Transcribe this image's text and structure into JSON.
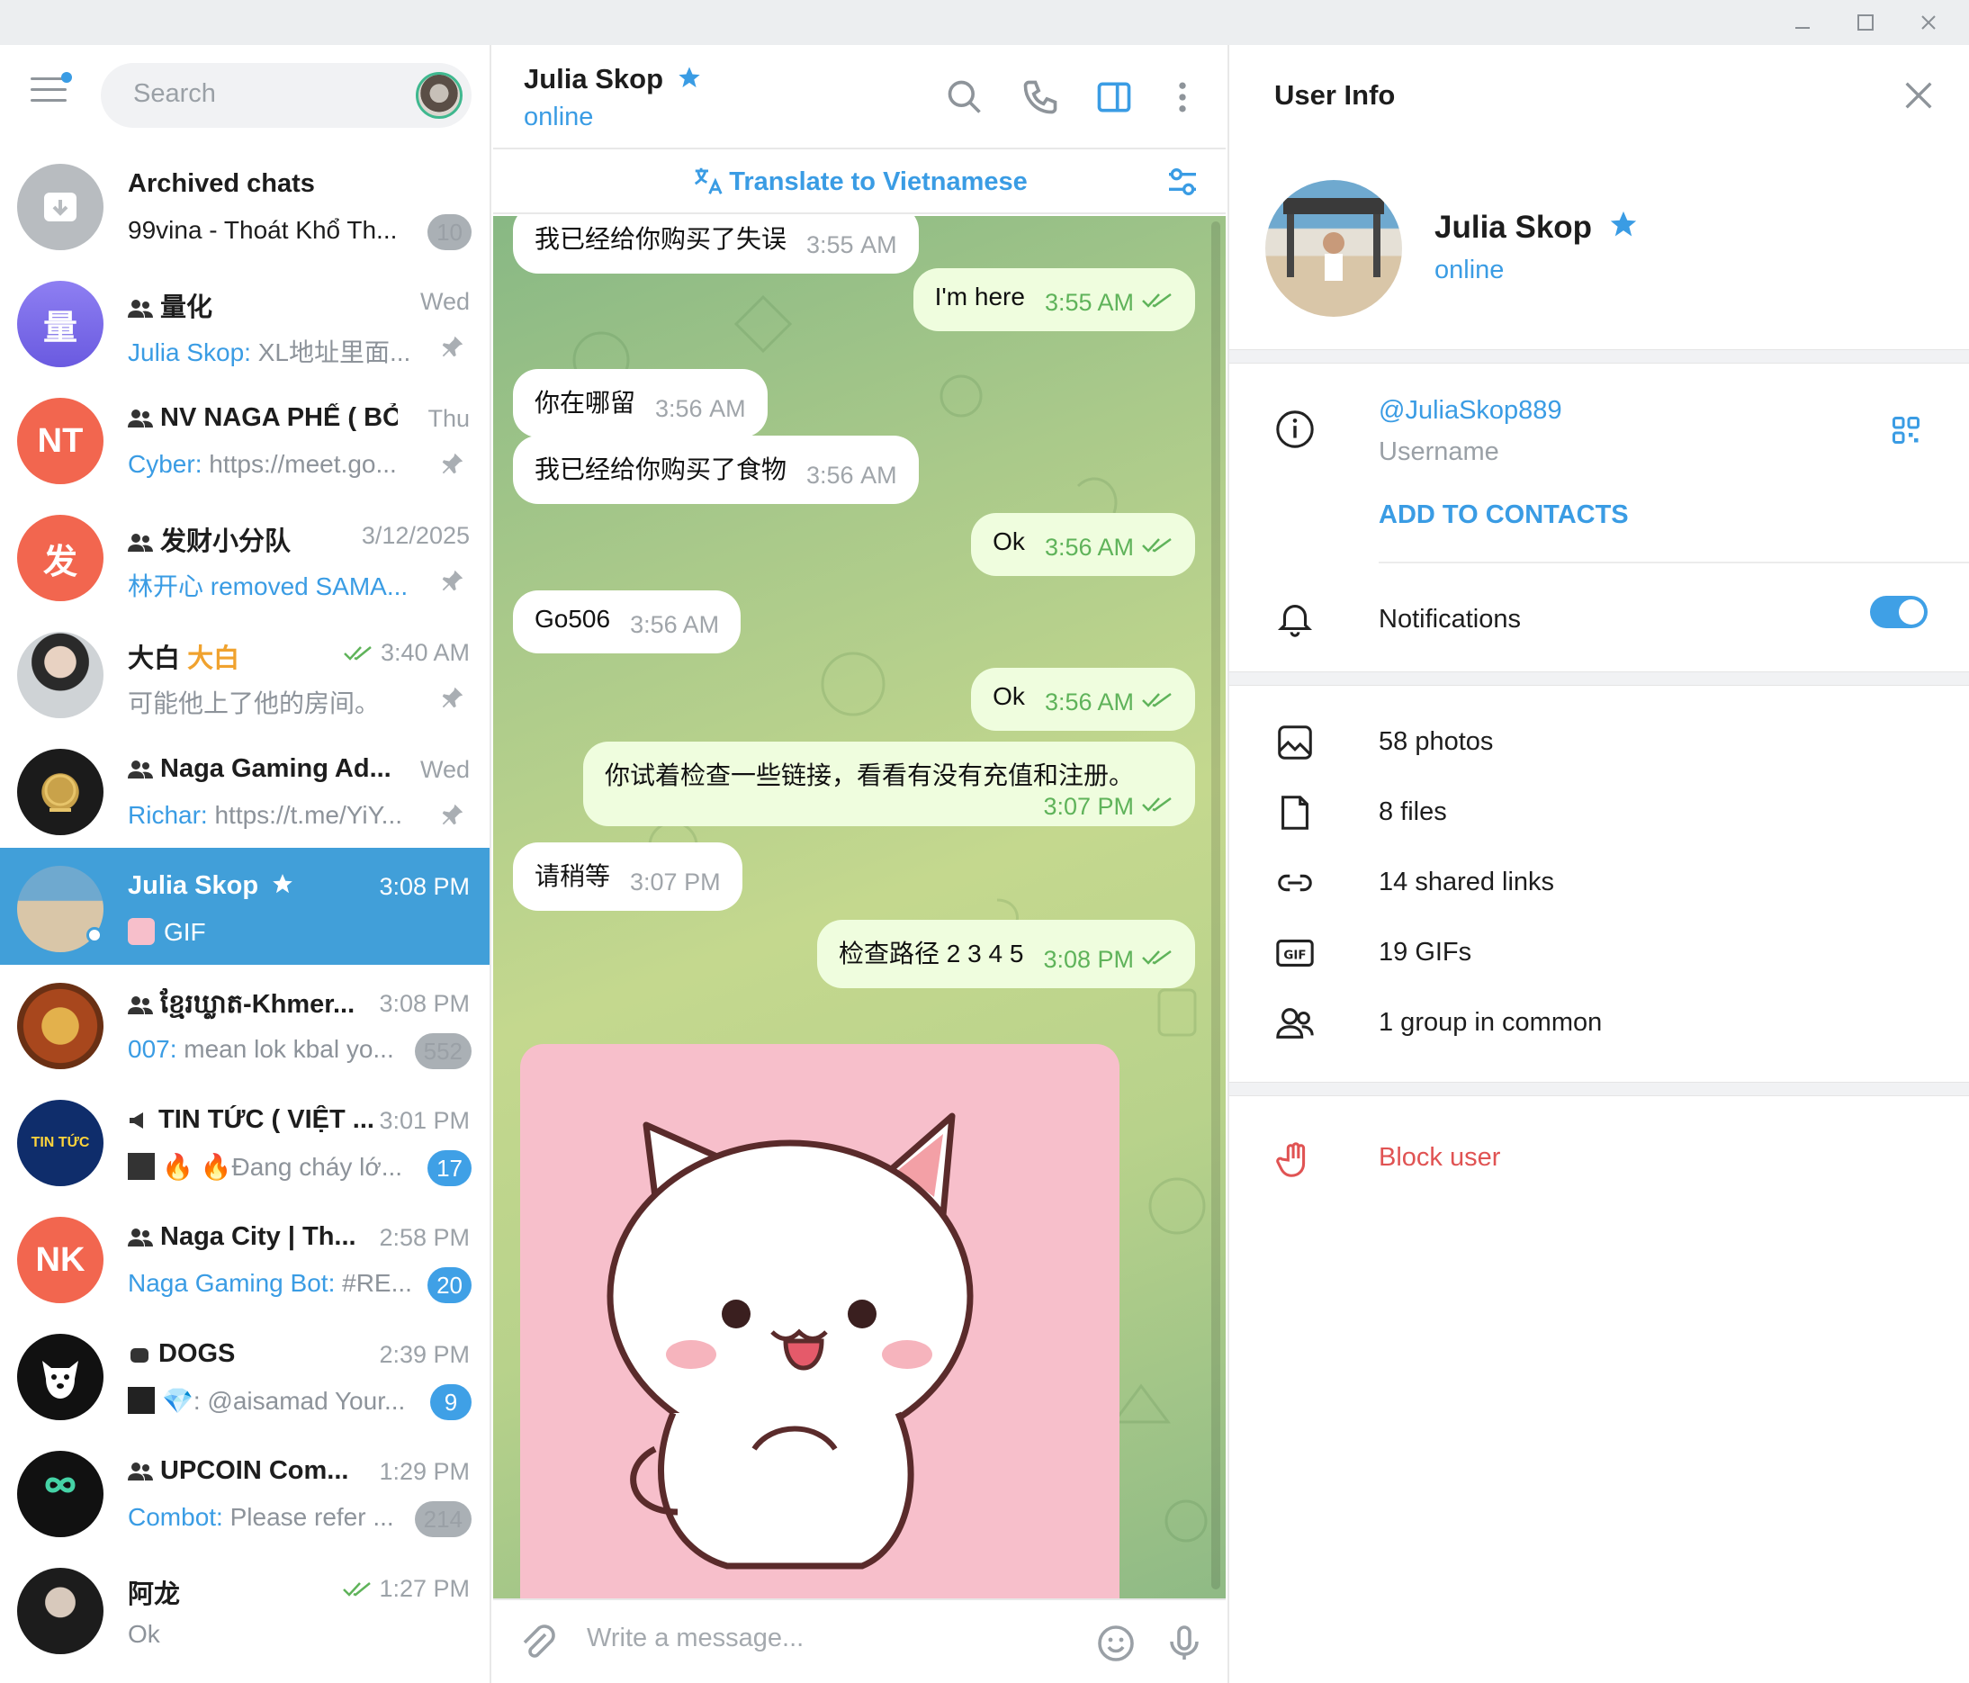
{
  "search": {
    "placeholder": "Search"
  },
  "chats": [
    {
      "title": "Archived chats",
      "msg": "99vina - Thoát Khổ Th...",
      "badge": "10",
      "badge_muted": true
    },
    {
      "title": "量化",
      "time": "Wed",
      "sender": "Julia Skop:",
      "msg": " XL地址里面...",
      "initial": "量",
      "color": "#7b6bea"
    },
    {
      "title": "NV NAGA PHẾ ( BỎ...",
      "time": "Thu",
      "sender": "Cyber:",
      "msg": " https://meet.go...",
      "initial": "NT",
      "color": "#f2664f"
    },
    {
      "title": "发财小分队",
      "time": "3/12/2025",
      "sender": "林开心 removed SAMA...",
      "msg": "",
      "initial": "发",
      "color": "#f2664f"
    },
    {
      "title": "大白",
      "title_tag": "大白",
      "time": "3:40 AM",
      "msg": "可能他上了他的房间。"
    },
    {
      "title": "Naga Gaming Ad...",
      "time": "Wed",
      "sender": "Richar:",
      "msg": " https://t.me/YiY..."
    },
    {
      "title": "Julia Skop",
      "time": "3:08 PM",
      "msg": "GIF"
    },
    {
      "title": "ខ្មែរឃ្លាត-Khmer...",
      "time": "3:08 PM",
      "sender": "007:",
      "msg": " mean lok kbal yo...",
      "badge": "552",
      "badge_muted": true
    },
    {
      "title": "TIN TỨC ( VIỆT ...",
      "time": "3:01 PM",
      "msg": "🔥 🔥Đang cháy lớ...",
      "badge": "17"
    },
    {
      "title": "Naga City | Th...",
      "time": "2:58 PM",
      "sender": "Naga Gaming Bot:",
      "msg": " #RE...",
      "badge": "20",
      "initial": "NK",
      "color": "#f2664f"
    },
    {
      "title": "DOGS",
      "time": "2:39 PM",
      "msg": "💎: @aisamad Your...",
      "badge": "9"
    },
    {
      "title": "UPCOIN Com...",
      "time": "1:29 PM",
      "sender": "Combot:",
      "msg": " Please refer ...",
      "badge": "214",
      "badge_muted": true
    },
    {
      "title": "阿龙",
      "time": "1:27 PM",
      "msg": "Ok"
    }
  ],
  "chat": {
    "name": "Julia Skop",
    "status": "online",
    "translate": "Translate to Vietnamese",
    "composer_placeholder": "Write a message...",
    "messages": [
      {
        "dir": "in",
        "text": "我已经给你购买了失误",
        "time": "3:55 AM"
      },
      {
        "dir": "out",
        "text": "I'm here",
        "time": "3:55 AM"
      },
      {
        "dir": "in",
        "text": "你在哪留",
        "time": "3:56 AM"
      },
      {
        "dir": "in",
        "text": "我已经给你购买了食物",
        "time": "3:56 AM"
      },
      {
        "dir": "out",
        "text": "Ok",
        "time": "3:56 AM"
      },
      {
        "dir": "in",
        "text": "Go506",
        "time": "3:56 AM"
      },
      {
        "dir": "out",
        "text": "Ok",
        "time": "3:56 AM"
      },
      {
        "dir": "out",
        "text": "你试着检查一些链接，看看有没有充值和注册。",
        "time": "3:07 PM"
      },
      {
        "dir": "in",
        "text": "请稍等",
        "time": "3:07 PM"
      },
      {
        "dir": "out",
        "text": "检查路径 2 3 4 5",
        "time": "3:08 PM"
      }
    ]
  },
  "info": {
    "title": "User Info",
    "name": "Julia Skop",
    "status": "online",
    "username": "@JuliaSkop889",
    "username_label": "Username",
    "add_contacts": "ADD TO CONTACTS",
    "notifications": "Notifications",
    "notifications_on": true,
    "media": [
      {
        "icon": "photo-icon",
        "label": "58 photos"
      },
      {
        "icon": "file-icon",
        "label": "8 files"
      },
      {
        "icon": "link-icon",
        "label": "14 shared links"
      },
      {
        "icon": "gif-icon",
        "label": "19 GIFs"
      },
      {
        "icon": "group-icon",
        "label": "1 group in common"
      }
    ],
    "block": "Block user"
  },
  "colors": {
    "accent": "#3a9ce4",
    "active": "#419fd9",
    "out_bubble": "#effdde",
    "block": "#e05353"
  }
}
